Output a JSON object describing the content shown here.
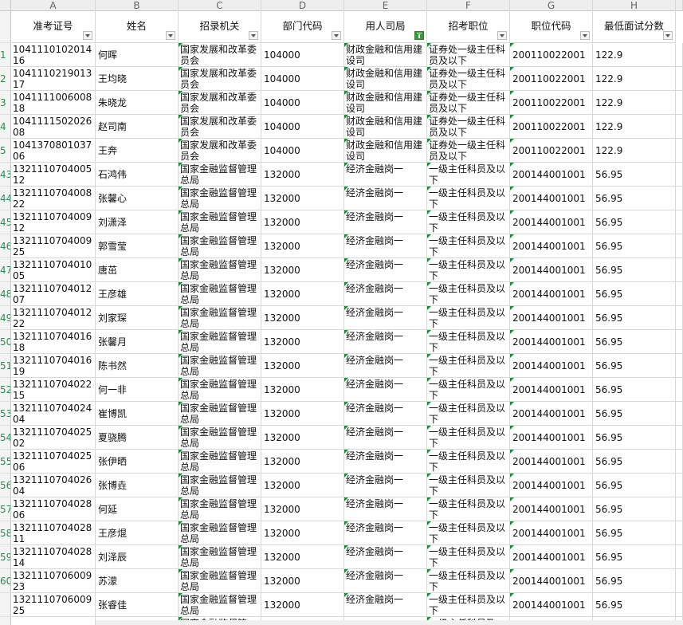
{
  "column_letters": [
    "A",
    "B",
    "C",
    "D",
    "E",
    "F",
    "G",
    "H"
  ],
  "headers": [
    "准考证号",
    "姓名",
    "招录机关",
    "部门代码",
    "用人司局",
    "招考职位",
    "职位代码",
    "最低面试分数"
  ],
  "active_filter_column": "用人司局",
  "row_numbers": [
    "1",
    "2",
    "3",
    "4",
    "5",
    "43",
    "44",
    "45",
    "46",
    "47",
    "48",
    "49",
    "50",
    "51",
    "52",
    "53",
    "54",
    "55",
    "56",
    "57",
    "58",
    "59",
    "60"
  ],
  "rows": [
    {
      "id": "104111010201416",
      "name": "何晖",
      "org": "国家发展和改革委员会",
      "dept": "104000",
      "bureau": "财政金融和信用建设司",
      "post": "证券处一级主任科员及以下",
      "post_code": "200110022001",
      "score": "122.9"
    },
    {
      "id": "104111021901317",
      "name": "王均晓",
      "org": "国家发展和改革委员会",
      "dept": "104000",
      "bureau": "财政金融和信用建设司",
      "post": "证券处一级主任科员及以下",
      "post_code": "200110022001",
      "score": "122.9"
    },
    {
      "id": "104111100600818",
      "name": "朱晓龙",
      "org": "国家发展和改革委员会",
      "dept": "104000",
      "bureau": "财政金融和信用建设司",
      "post": "证券处一级主任科员及以下",
      "post_code": "200110022001",
      "score": "122.9"
    },
    {
      "id": "104111150202608",
      "name": "赵司南",
      "org": "国家发展和改革委员会",
      "dept": "104000",
      "bureau": "财政金融和信用建设司",
      "post": "证券处一级主任科员及以下",
      "post_code": "200110022001",
      "score": "122.9"
    },
    {
      "id": "104137080103706",
      "name": "王奔",
      "org": "国家发展和改革委员会",
      "dept": "104000",
      "bureau": "财政金融和信用建设司",
      "post": "证券处一级主任科员及以下",
      "post_code": "200110022001",
      "score": "122.9"
    },
    {
      "id": "132111070400512",
      "name": "石鸿伟",
      "org": "国家金融监督管理总局",
      "dept": "132000",
      "bureau": "经济金融岗一",
      "post": "一级主任科员及以下",
      "post_code": "200144001001",
      "score": "56.95"
    },
    {
      "id": "132111070400822",
      "name": "张馨心",
      "org": "国家金融监督管理总局",
      "dept": "132000",
      "bureau": "经济金融岗一",
      "post": "一级主任科员及以下",
      "post_code": "200144001001",
      "score": "56.95"
    },
    {
      "id": "132111070400912",
      "name": "刘潇泽",
      "org": "国家金融监督管理总局",
      "dept": "132000",
      "bureau": "经济金融岗一",
      "post": "一级主任科员及以下",
      "post_code": "200144001001",
      "score": "56.95"
    },
    {
      "id": "132111070400925",
      "name": "郭雪莹",
      "org": "国家金融监督管理总局",
      "dept": "132000",
      "bureau": "经济金融岗一",
      "post": "一级主任科员及以下",
      "post_code": "200144001001",
      "score": "56.95"
    },
    {
      "id": "132111070401005",
      "name": "唐茁",
      "org": "国家金融监督管理总局",
      "dept": "132000",
      "bureau": "经济金融岗一",
      "post": "一级主任科员及以下",
      "post_code": "200144001001",
      "score": "56.95"
    },
    {
      "id": "132111070401207",
      "name": "王彦雄",
      "org": "国家金融监督管理总局",
      "dept": "132000",
      "bureau": "经济金融岗一",
      "post": "一级主任科员及以下",
      "post_code": "200144001001",
      "score": "56.95"
    },
    {
      "id": "132111070401222",
      "name": "刘家琛",
      "org": "国家金融监督管理总局",
      "dept": "132000",
      "bureau": "经济金融岗一",
      "post": "一级主任科员及以下",
      "post_code": "200144001001",
      "score": "56.95"
    },
    {
      "id": "132111070401618",
      "name": "张馨月",
      "org": "国家金融监督管理总局",
      "dept": "132000",
      "bureau": "经济金融岗一",
      "post": "一级主任科员及以下",
      "post_code": "200144001001",
      "score": "56.95"
    },
    {
      "id": "132111070401619",
      "name": "陈书然",
      "org": "国家金融监督管理总局",
      "dept": "132000",
      "bureau": "经济金融岗一",
      "post": "一级主任科员及以下",
      "post_code": "200144001001",
      "score": "56.95"
    },
    {
      "id": "132111070402215",
      "name": "何一非",
      "org": "国家金融监督管理总局",
      "dept": "132000",
      "bureau": "经济金融岗一",
      "post": "一级主任科员及以下",
      "post_code": "200144001001",
      "score": "56.95"
    },
    {
      "id": "132111070402404",
      "name": "崔博凯",
      "org": "国家金融监督管理总局",
      "dept": "132000",
      "bureau": "经济金融岗一",
      "post": "一级主任科员及以下",
      "post_code": "200144001001",
      "score": "56.95"
    },
    {
      "id": "132111070402502",
      "name": "夏骁腾",
      "org": "国家金融监督管理总局",
      "dept": "132000",
      "bureau": "经济金融岗一",
      "post": "一级主任科员及以下",
      "post_code": "200144001001",
      "score": "56.95"
    },
    {
      "id": "132111070402506",
      "name": "张伊晒",
      "org": "国家金融监督管理总局",
      "dept": "132000",
      "bureau": "经济金融岗一",
      "post": "一级主任科员及以下",
      "post_code": "200144001001",
      "score": "56.95"
    },
    {
      "id": "132111070402604",
      "name": "张博垚",
      "org": "国家金融监督管理总局",
      "dept": "132000",
      "bureau": "经济金融岗一",
      "post": "一级主任科员及以下",
      "post_code": "200144001001",
      "score": "56.95"
    },
    {
      "id": "132111070402806",
      "name": "何延",
      "org": "国家金融监督管理总局",
      "dept": "132000",
      "bureau": "经济金融岗一",
      "post": "一级主任科员及以下",
      "post_code": "200144001001",
      "score": "56.95"
    },
    {
      "id": "132111070402811",
      "name": "王彦焜",
      "org": "国家金融监督管理总局",
      "dept": "132000",
      "bureau": "经济金融岗一",
      "post": "一级主任科员及以下",
      "post_code": "200144001001",
      "score": "56.95"
    },
    {
      "id": "132111070402814",
      "name": "刘泽辰",
      "org": "国家金融监督管理总局",
      "dept": "132000",
      "bureau": "经济金融岗一",
      "post": "一级主任科员及以下",
      "post_code": "200144001001",
      "score": "56.95"
    },
    {
      "id": "132111070600923",
      "name": "苏濛",
      "org": "国家金融监督管理总局",
      "dept": "132000",
      "bureau": "经济金融岗一",
      "post": "一级主任科员及以下",
      "post_code": "200144001001",
      "score": "56.95"
    },
    {
      "id": "132111070600925",
      "name": "张睿佳",
      "org": "国家金融监督管理总局",
      "dept": "132000",
      "bureau": "经济金融岗一",
      "post": "一级主任科员及以下",
      "post_code": "200144001001",
      "score": "56.95"
    },
    {
      "id": "",
      "name": "",
      "org": "国家金融监督管",
      "dept": "",
      "bureau": "",
      "post": "一级主任科员及",
      "post_code": "",
      "score": ""
    }
  ],
  "colors": {
    "row_number": "#2e8b57",
    "comment_marker": "#1e8a3c",
    "active_filter": "#3a9b3a",
    "grid": "#d9d9d9"
  }
}
